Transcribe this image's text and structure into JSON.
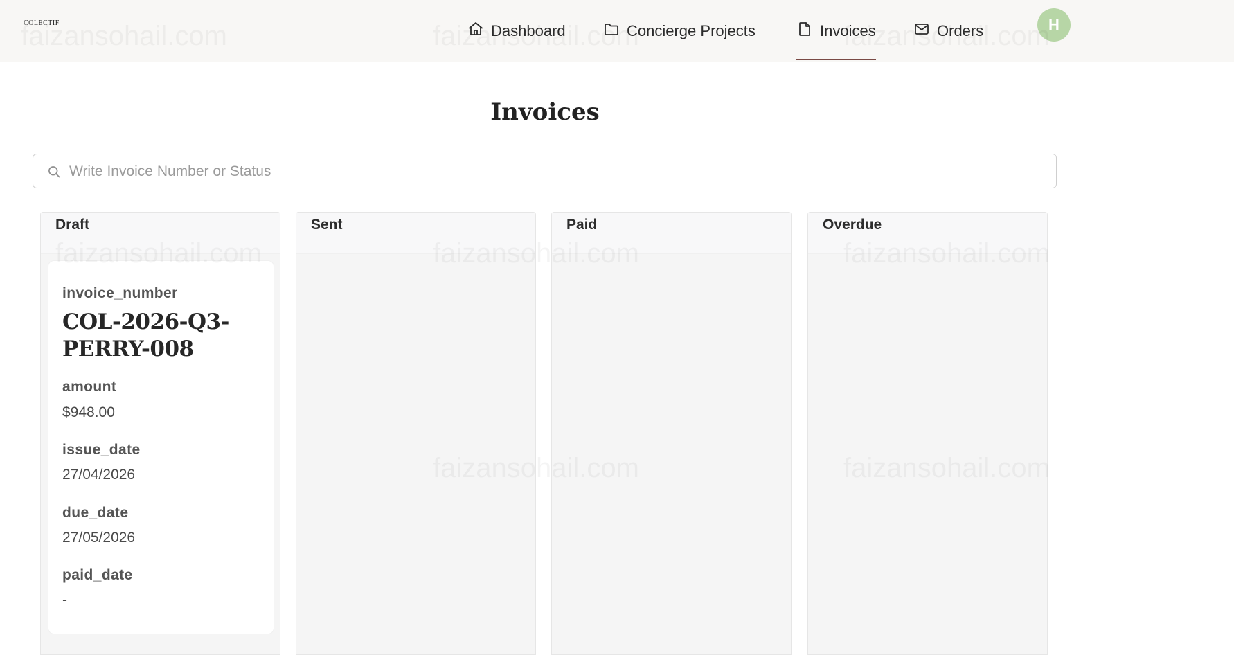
{
  "brand": {
    "logo_text": "COLECTIF"
  },
  "nav": {
    "items": [
      {
        "label": "Dashboard",
        "icon": "home-icon",
        "active": false
      },
      {
        "label": "Concierge Projects",
        "icon": "folder-icon",
        "active": false
      },
      {
        "label": "Invoices",
        "icon": "file-icon",
        "active": true
      },
      {
        "label": "Orders",
        "icon": "mail-icon",
        "active": false
      }
    ],
    "avatar_initial": "H"
  },
  "watermark": "faizansohail.com",
  "page": {
    "title": "Invoices"
  },
  "search": {
    "placeholder": "Write Invoice Number or Status",
    "value": ""
  },
  "columns": [
    {
      "title": "Draft"
    },
    {
      "title": "Sent"
    },
    {
      "title": "Paid"
    },
    {
      "title": "Overdue"
    }
  ],
  "card": {
    "invoice_number_label": "invoice_number",
    "invoice_number": "COL-2026-Q3-PERRY-008",
    "amount_label": "amount",
    "amount": "$948.00",
    "issue_date_label": "issue_date",
    "issue_date": "27/04/2026",
    "due_date_label": "due_date",
    "due_date": "27/05/2026",
    "paid_date_label": "paid_date",
    "paid_date": "-"
  },
  "colors": {
    "header_bg": "#f8f7f5",
    "active_underline": "#7a4a45",
    "avatar_bg": "#b7d6a6",
    "column_bg": "#f5f5f5"
  }
}
